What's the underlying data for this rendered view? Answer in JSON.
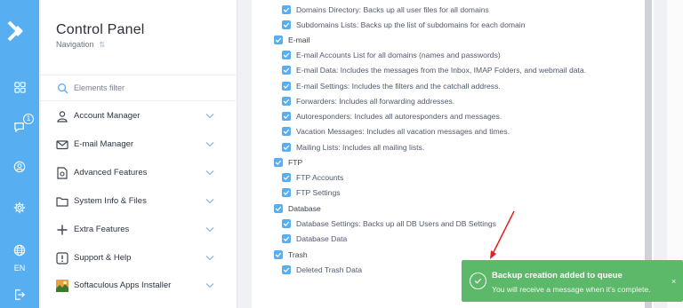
{
  "sidebar": {
    "title": "Control Panel",
    "subtitle": "Navigation",
    "search_placeholder": "Elements filter",
    "items": [
      {
        "label": "Account Manager",
        "icon": "user-icon"
      },
      {
        "label": "E-mail Manager",
        "icon": "envelope-icon"
      },
      {
        "label": "Advanced Features",
        "icon": "gear-doc-icon"
      },
      {
        "label": "System Info & Files",
        "icon": "folder-icon"
      },
      {
        "label": "Extra Features",
        "icon": "plus-icon"
      },
      {
        "label": "Support & Help",
        "icon": "exclamation-icon"
      },
      {
        "label": "Softaculous Apps Installer",
        "icon": "softaculous-logo"
      }
    ]
  },
  "rail": {
    "notification_count": "1",
    "language": "EN"
  },
  "backup_options": [
    {
      "label": "Domains Directory: Backs up all user files for all domains",
      "level": 1
    },
    {
      "label": "Subdomains Lists: Backs up the list of subdomains for each domain",
      "level": 1
    },
    {
      "label": "E-mail",
      "level": 0
    },
    {
      "label": "E-mail Accounts List for all domains (names and passwords)",
      "level": 1
    },
    {
      "label": "E-mail Data: Includes the messages from the Inbox, IMAP Folders, and webmail data.",
      "level": 1
    },
    {
      "label": "E-mail Settings: Includes the filters and the catchall address.",
      "level": 1
    },
    {
      "label": "Forwarders: Includes all forwarding addresses.",
      "level": 1
    },
    {
      "label": "Autoresponders: Includes all autoresponders and messages.",
      "level": 1
    },
    {
      "label": "Vacation Messages: Includes all vacation messages and times.",
      "level": 1
    },
    {
      "label": "Mailing Lists: Includes all mailing lists.",
      "level": 1
    },
    {
      "label": "FTP",
      "level": 0
    },
    {
      "label": "FTP Accounts",
      "level": 1
    },
    {
      "label": "FTP Settings",
      "level": 1
    },
    {
      "label": "Database",
      "level": 0
    },
    {
      "label": "Database Settings: Backs up all DB Users and DB Settings",
      "level": 1
    },
    {
      "label": "Database Data",
      "level": 1
    },
    {
      "label": "Trash",
      "level": 0
    },
    {
      "label": "Deleted Trash Data",
      "level": 1
    }
  ],
  "toast": {
    "title": "Backup creation added to queue",
    "message": "You will receive a message when it's complete.",
    "close": "×"
  },
  "colors": {
    "accent": "#57aef0",
    "toast": "#5cb96a",
    "annotation_arrow": "#e02020"
  }
}
